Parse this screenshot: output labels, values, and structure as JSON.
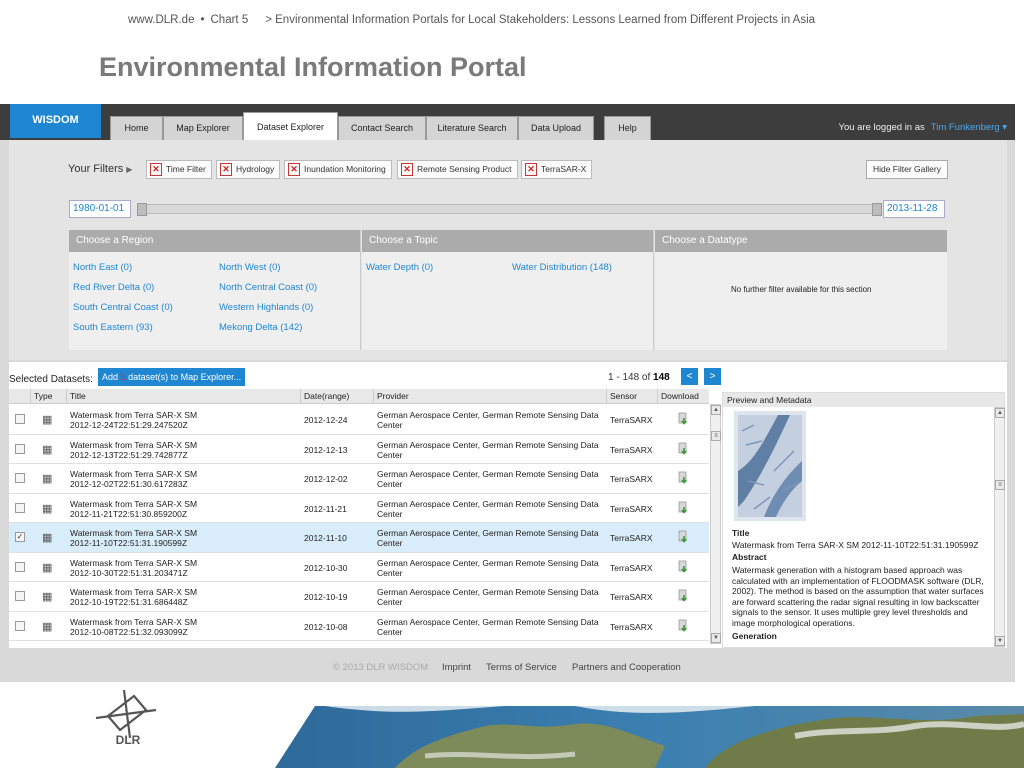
{
  "slide": {
    "site": "www.DLR.de",
    "bullet": "•",
    "chart": "Chart 5",
    "breadcrumb": "> Environmental Information Portals for Local Stakeholders: Lessons Learned from Different Projects in Asia",
    "title": "Environmental Information Portal",
    "logo_text": "DLR"
  },
  "app": {
    "brand": "WISDOM",
    "tabs": [
      "Home",
      "Map Explorer",
      "Dataset Explorer",
      "Contact Search",
      "Literature Search",
      "Data Upload",
      "Help"
    ],
    "active_tab": "Dataset Explorer",
    "login_text": "You are logged in as",
    "user": "Tim Funkenberg ▾",
    "accent": "#1f86d1"
  },
  "filters": {
    "label": "Your Filters",
    "chips": [
      "Time Filter",
      "Hydrology",
      "Inundation Monitoring",
      "Remote Sensing Product",
      "TerraSAR-X"
    ],
    "hide_button": "Hide Filter Gallery",
    "date_start": "1980-01-01",
    "date_end": "2013-11-28"
  },
  "facets": {
    "region": {
      "heading": "Choose a Region",
      "items": [
        "North East (0)",
        "North West (0)",
        "Red River Delta (0)",
        "North Central Coast (0)",
        "South Central Coast (0)",
        "Western Highlands (0)",
        "South Eastern (93)",
        "Mekong Delta (142)"
      ]
    },
    "topic": {
      "heading": "Choose a Topic",
      "items": [
        "Water Depth (0)",
        "Water Distribution (148)"
      ]
    },
    "datatype": {
      "heading": "Choose a Datatype",
      "note": "No further filter available for this section"
    }
  },
  "datasets": {
    "selected_label": "Selected Datasets:",
    "add_prefix": "Add",
    "add_count": "1",
    "add_suffix": "dataset(s) to Map Explorer...",
    "pager_text": "1 - 148 of",
    "pager_total": "148",
    "prev": "<",
    "next": ">",
    "columns": [
      "Type",
      "Title",
      "Date(range)",
      "Provider",
      "Sensor",
      "Download"
    ],
    "rows": [
      {
        "title1": "Watermask from Terra SAR-X SM",
        "title2": "2012-12-24T22:51:29.247520Z",
        "date": "2012-12-24",
        "prov1": "German Aerospace Center, German Remote Sensing Data",
        "prov2": "Center",
        "sensor": "TerraSARX",
        "checked": ""
      },
      {
        "title1": "Watermask from Terra SAR-X SM",
        "title2": "2012-12-13T22:51:29.742877Z",
        "date": "2012-12-13",
        "prov1": "German Aerospace Center, German Remote Sensing Data",
        "prov2": "Center",
        "sensor": "TerraSARX",
        "checked": ""
      },
      {
        "title1": "Watermask from Terra SAR-X SM",
        "title2": "2012-12-02T22:51:30.617283Z",
        "date": "2012-12-02",
        "prov1": "German Aerospace Center, German Remote Sensing Data",
        "prov2": "Center",
        "sensor": "TerraSARX",
        "checked": ""
      },
      {
        "title1": "Watermask from Terra SAR-X SM",
        "title2": "2012-11-21T22:51:30.859200Z",
        "date": "2012-11-21",
        "prov1": "German Aerospace Center, German Remote Sensing Data",
        "prov2": "Center",
        "sensor": "TerraSARX",
        "checked": ""
      },
      {
        "title1": "Watermask from Terra SAR-X SM",
        "title2": "2012-11-10T22:51:31.190599Z",
        "date": "2012-11-10",
        "prov1": "German Aerospace Center, German Remote Sensing Data",
        "prov2": "Center",
        "sensor": "TerraSARX",
        "checked": "✓"
      },
      {
        "title1": "Watermask from Terra SAR-X SM",
        "title2": "2012-10-30T22:51:31.203471Z",
        "date": "2012-10-30",
        "prov1": "German Aerospace Center, German Remote Sensing Data",
        "prov2": "Center",
        "sensor": "TerraSARX",
        "checked": ""
      },
      {
        "title1": "Watermask from Terra SAR-X SM",
        "title2": "2012-10-19T22:51:31.686448Z",
        "date": "2012-10-19",
        "prov1": "German Aerospace Center, German Remote Sensing Data",
        "prov2": "Center",
        "sensor": "TerraSARX",
        "checked": ""
      },
      {
        "title1": "Watermask from Terra SAR-X SM",
        "title2": "2012-10-08T22:51:32.093099Z",
        "date": "2012-10-08",
        "prov1": "German Aerospace Center, German Remote Sensing Data",
        "prov2": "Center",
        "sensor": "TerraSARX",
        "checked": ""
      }
    ]
  },
  "preview": {
    "heading": "Preview and Metadata",
    "title_label": "Title",
    "title_value": "Watermask from Terra SAR-X SM 2012-11-10T22:51:31.190599Z",
    "abstract_label": "Abstract",
    "abstract_lines": [
      "Watermask generation with a histogram based approach was",
      "calculated with an implementation of FLOODMASK software (DLR,",
      "2002). The method is based on the assumption that water surfaces",
      "are forward scattering the radar signal resulting in low backscatter",
      "signals to the sensor. It uses multiple grey level thresholds and",
      "image morphological operations."
    ],
    "generation_label": "Generation"
  },
  "footer": {
    "copyright": "© 2013 DLR WISDOM",
    "links": [
      "Imprint",
      "Terms of Service",
      "Partners and Cooperation"
    ]
  }
}
